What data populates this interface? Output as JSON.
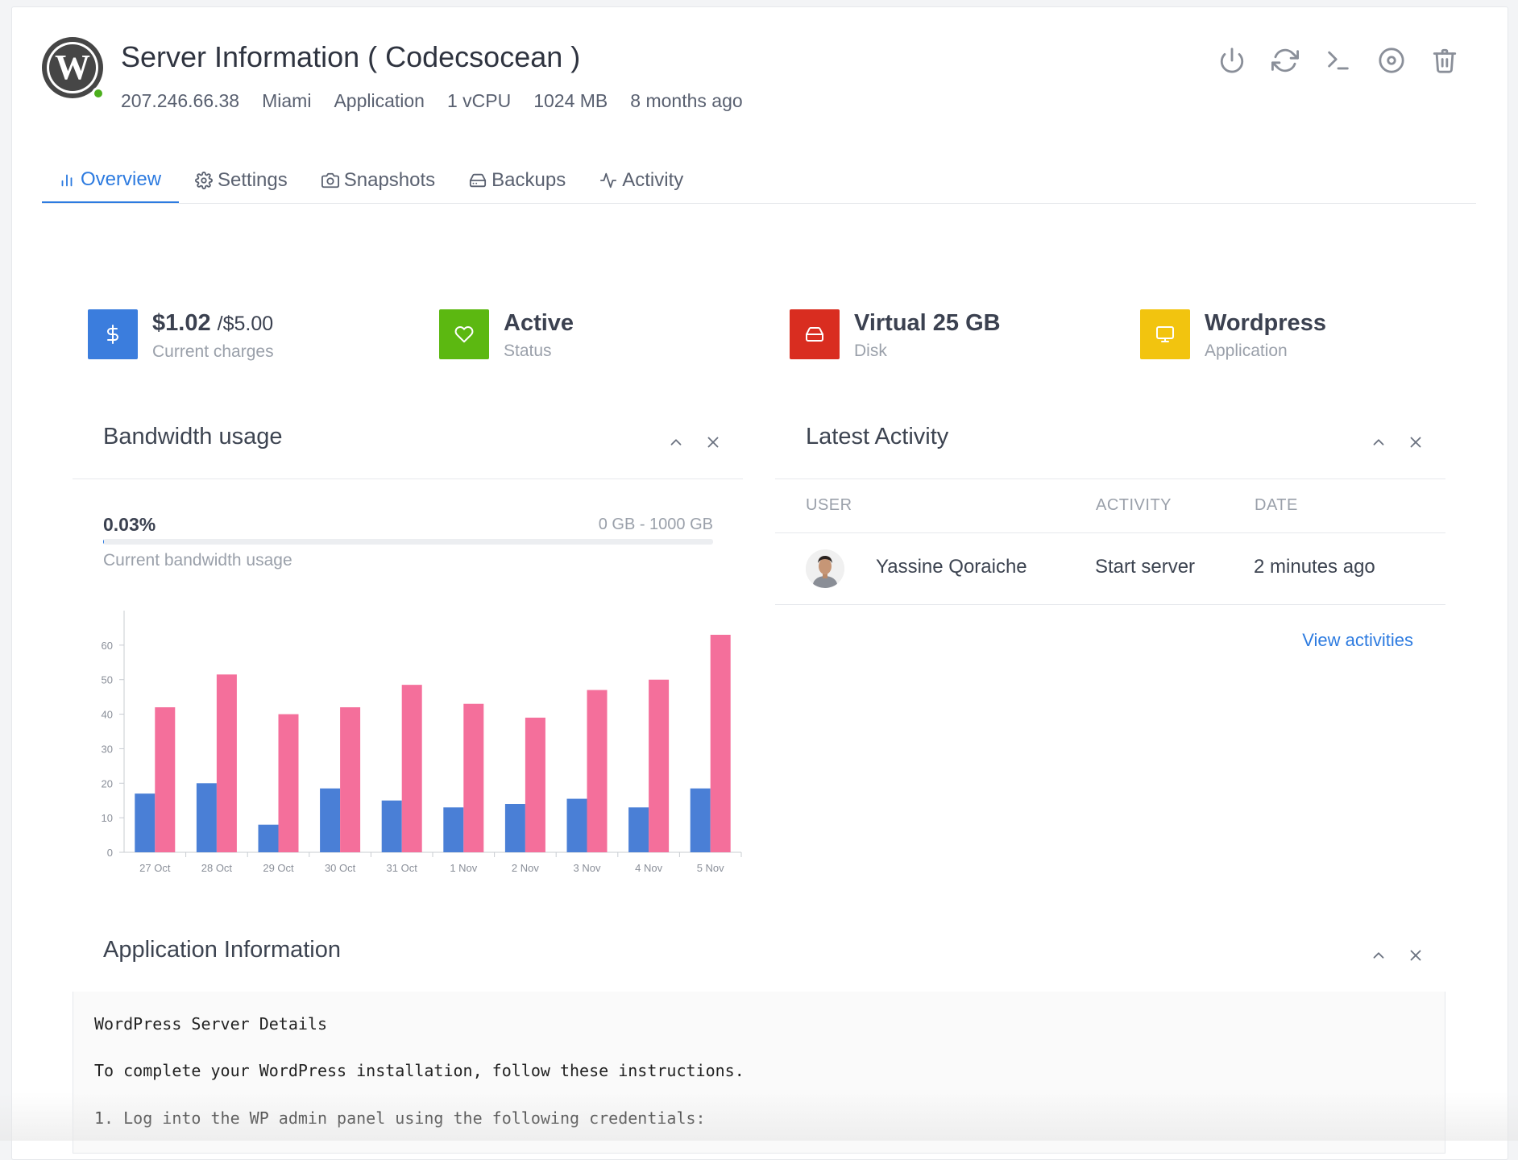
{
  "header": {
    "title": "Server Information ( Codecsocean )",
    "meta": [
      "207.246.66.38",
      "Miami",
      "Application",
      "1 vCPU",
      "1024 MB",
      "8 months ago"
    ],
    "status_color": "#4caf1d",
    "actions": [
      "power-icon",
      "refresh-icon",
      "terminal-icon",
      "disc-icon",
      "trash-icon"
    ]
  },
  "tabs": [
    {
      "label": "Overview",
      "icon": "bar-chart-icon",
      "active": true
    },
    {
      "label": "Settings",
      "icon": "gear-icon"
    },
    {
      "label": "Snapshots",
      "icon": "camera-icon"
    },
    {
      "label": "Backups",
      "icon": "hard-drive-icon"
    },
    {
      "label": "Activity",
      "icon": "activity-icon"
    }
  ],
  "stats": [
    {
      "main": "$1.02",
      "sub": "/$5.00",
      "label": "Current charges",
      "icon": "dollar-icon",
      "color": "#3b7ddd"
    },
    {
      "main": "Active",
      "label": "Status",
      "icon": "heart-icon",
      "color": "#5cb811"
    },
    {
      "main": "Virtual 25 GB",
      "label": "Disk",
      "icon": "hard-drive-icon",
      "color": "#d92d20"
    },
    {
      "main": "Wordpress",
      "label": "Application",
      "icon": "monitor-icon",
      "color": "#f2c40f"
    }
  ],
  "bandwidth": {
    "title": "Bandwidth usage",
    "percent": "0.03%",
    "percent_value": 0.0003,
    "range": "0 GB - 1000 GB",
    "label": "Current bandwidth usage"
  },
  "chart_data": {
    "type": "bar",
    "categories": [
      "27 Oct",
      "28 Oct",
      "29 Oct",
      "30 Oct",
      "31 Oct",
      "1 Nov",
      "2 Nov",
      "3 Nov",
      "4 Nov",
      "5 Nov"
    ],
    "series": [
      {
        "values": [
          17,
          20,
          8,
          18.5,
          15,
          13,
          14,
          15.5,
          13,
          18.5
        ],
        "color": "#4a7fd6"
      },
      {
        "values": [
          42,
          51.5,
          40,
          42,
          48.5,
          43,
          39,
          47,
          50,
          63
        ],
        "color": "#f46f9b"
      }
    ],
    "yticks": [
      0,
      10,
      20,
      30,
      40,
      50,
      60
    ],
    "ylim": [
      0,
      70
    ],
    "grid": false
  },
  "activity": {
    "title": "Latest Activity",
    "columns": [
      "USER",
      "ACTIVITY",
      "DATE"
    ],
    "rows": [
      {
        "user": "Yassine Qoraiche",
        "activity": "Start server",
        "date": "2 minutes ago"
      }
    ],
    "link": "View activities"
  },
  "app_info": {
    "title": "Application Information",
    "lines": [
      "WordPress Server Details",
      "To complete your WordPress installation, follow these instructions.",
      "1. Log into the WP admin panel using the following credentials:"
    ]
  }
}
